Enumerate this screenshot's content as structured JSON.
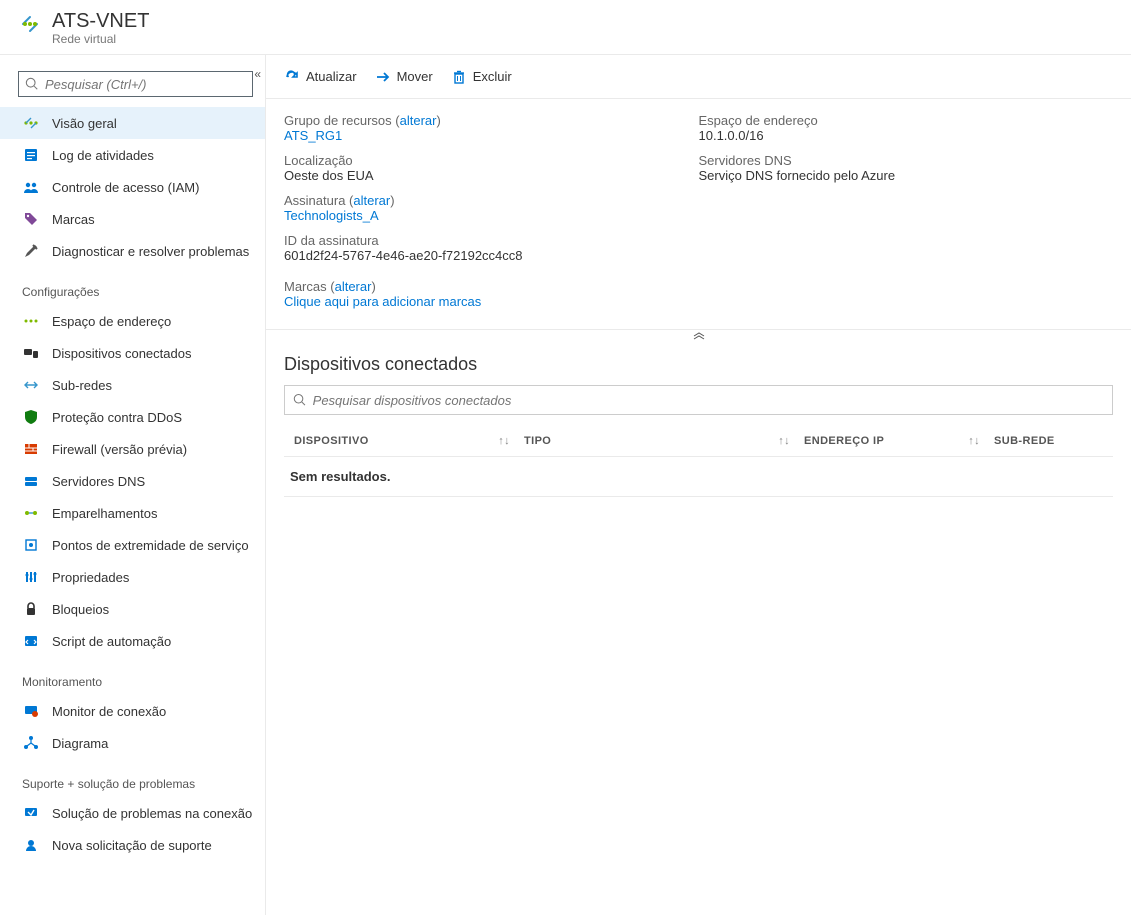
{
  "header": {
    "title": "ATS-VNET",
    "subtitle": "Rede virtual"
  },
  "sidebar": {
    "search_placeholder": "Pesquisar (Ctrl+/)",
    "top_items": [
      {
        "label": "Visão geral"
      },
      {
        "label": "Log de atividades"
      },
      {
        "label": "Controle de acesso (IAM)"
      },
      {
        "label": "Marcas"
      },
      {
        "label": "Diagnosticar e resolver problemas"
      }
    ],
    "sections": [
      {
        "title": "Configurações",
        "items": [
          {
            "label": "Espaço de endereço"
          },
          {
            "label": "Dispositivos conectados"
          },
          {
            "label": "Sub-redes"
          },
          {
            "label": "Proteção contra DDoS"
          },
          {
            "label": "Firewall (versão prévia)"
          },
          {
            "label": "Servidores DNS"
          },
          {
            "label": "Emparelhamentos"
          },
          {
            "label": "Pontos de extremidade de serviço"
          },
          {
            "label": "Propriedades"
          },
          {
            "label": "Bloqueios"
          },
          {
            "label": "Script de automação"
          }
        ]
      },
      {
        "title": "Monitoramento",
        "items": [
          {
            "label": "Monitor de conexão"
          },
          {
            "label": "Diagrama"
          }
        ]
      },
      {
        "title": "Suporte + solução de problemas",
        "items": [
          {
            "label": "Solução de problemas na conexão"
          },
          {
            "label": "Nova solicitação de suporte"
          }
        ]
      }
    ]
  },
  "toolbar": {
    "refresh": "Atualizar",
    "move": "Mover",
    "delete": "Excluir"
  },
  "essentials": {
    "resource_group_label": "Grupo de recursos",
    "resource_group_value": "ATS_RG1",
    "change": "alterar",
    "location_label": "Localização",
    "location_value": "Oeste dos EUA",
    "subscription_label": "Assinatura",
    "subscription_value": "Technologists_A",
    "subscription_id_label": "ID da assinatura",
    "subscription_id_value": "601d2f24-5767-4e46-ae20-f72192cc4cc8",
    "tags_label": "Marcas",
    "tags_value": "Clique aqui para adicionar marcas",
    "address_space_label": "Espaço de endereço",
    "address_space_value": "10.1.0.0/16",
    "dns_label": "Servidores DNS",
    "dns_value": "Serviço DNS fornecido pelo Azure"
  },
  "devices": {
    "title": "Dispositivos conectados",
    "search_placeholder": "Pesquisar dispositivos conectados",
    "col_device": "DISPOSITIVO",
    "col_type": "TIPO",
    "col_ip": "ENDEREÇO IP",
    "col_subnet": "SUB-REDE",
    "no_results": "Sem resultados."
  }
}
